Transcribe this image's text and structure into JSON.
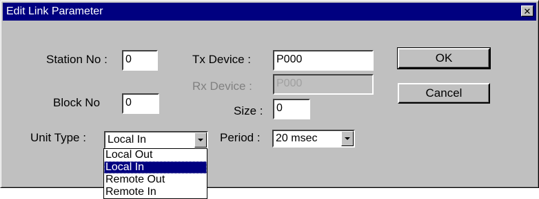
{
  "window": {
    "title": "Edit Link Parameter",
    "close_symbol": "✕"
  },
  "form": {
    "station_no": {
      "label": "Station No :",
      "value": "0"
    },
    "block_no": {
      "label": "Block No",
      "value": "0"
    },
    "unit_type": {
      "label": "Unit Type :",
      "selected": "Local In",
      "options": [
        "Local Out",
        "Local In",
        "Remote Out",
        "Remote In"
      ],
      "highlighted_index": 1
    },
    "tx_device": {
      "label": "Tx Device :",
      "value": "P000"
    },
    "rx_device": {
      "label": "Rx Device :",
      "value": "P000",
      "disabled": true
    },
    "size": {
      "label": "Size :",
      "value": "0"
    },
    "period": {
      "label": "Period :",
      "selected": "20 msec"
    }
  },
  "buttons": {
    "ok": "OK",
    "cancel": "Cancel"
  },
  "icons": {
    "close": "close-icon",
    "dropdown": "chevron-down-icon"
  },
  "colors": {
    "titlebar": "#000080",
    "face": "#c0c0c0",
    "selection": "#000080"
  }
}
